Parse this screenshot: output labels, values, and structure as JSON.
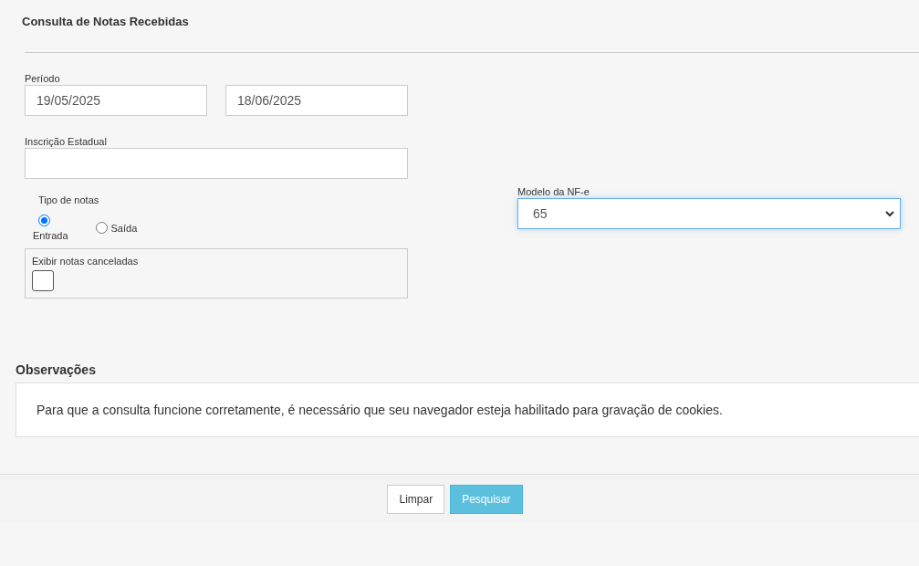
{
  "title": "Consulta de Notas Recebidas",
  "periodo": {
    "label": "Período",
    "start": "19/05/2025",
    "end": "18/06/2025"
  },
  "inscricao": {
    "label": "Inscrição Estadual"
  },
  "tipo_notas": {
    "label": "Tipo de notas",
    "options": [
      {
        "label": "Entrada",
        "selected": true,
        "kind": "below"
      },
      {
        "label": "Saída",
        "selected": false,
        "kind": "inline"
      }
    ]
  },
  "canceladas": {
    "label": "Exibir notas canceladas",
    "checked": false
  },
  "modelo": {
    "label": "Modelo da NF-e",
    "value": "65"
  },
  "observacoes": {
    "title": "Observações",
    "text": "Para que a consulta funcione corretamente, é necessário que seu navegador esteja habilitado para gravação de cookies."
  },
  "buttons": [
    {
      "label": "Limpar",
      "kind": "default"
    },
    {
      "label": "Pesquisar",
      "kind": "primary"
    }
  ]
}
